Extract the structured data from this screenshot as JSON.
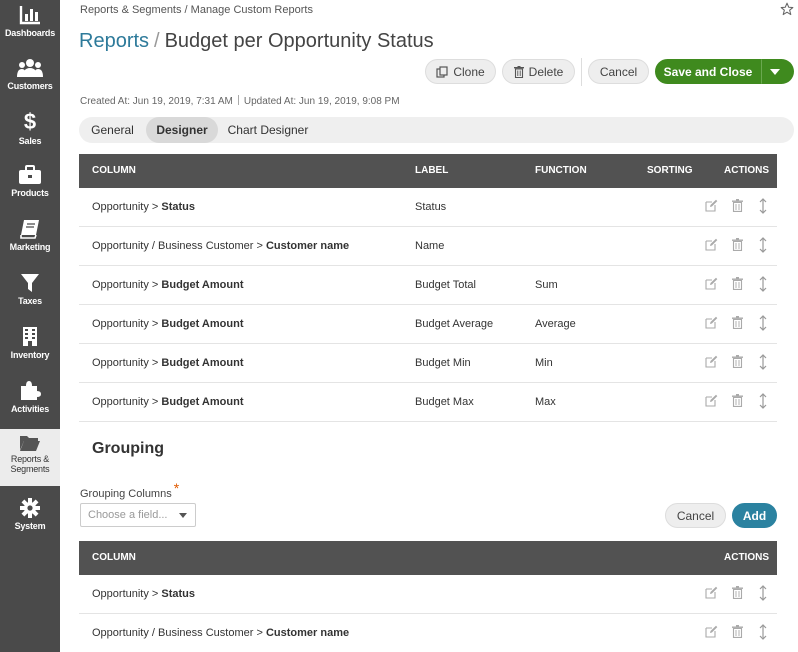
{
  "sidebar": {
    "items": [
      {
        "label": "Dashboards",
        "icon": "bar-chart-icon"
      },
      {
        "label": "Customers",
        "icon": "users-icon"
      },
      {
        "label": "Sales",
        "icon": "dollar-icon"
      },
      {
        "label": "Products",
        "icon": "briefcase-icon"
      },
      {
        "label": "Marketing",
        "icon": "book-icon"
      },
      {
        "label": "Taxes",
        "icon": "filter-icon"
      },
      {
        "label": "Inventory",
        "icon": "building-icon"
      },
      {
        "label": "Activities",
        "icon": "puzzle-icon"
      },
      {
        "label": "Reports &",
        "label2": "Segments",
        "icon": "folder-icon"
      },
      {
        "label": "System",
        "icon": "gear-icon"
      }
    ]
  },
  "breadcrumb": "Reports & Segments / Manage Custom Reports",
  "title": {
    "link": "Reports",
    "separator": "/",
    "name": "Budget per Opportunity Status"
  },
  "toolbar": {
    "clone": "Clone",
    "delete": "Delete",
    "cancel": "Cancel",
    "save": "Save and Close"
  },
  "meta": {
    "created": "Created At: Jun 19, 2019, 7:31 AM",
    "updated": "Updated At: Jun 19, 2019, 9:08 PM"
  },
  "tabs": [
    {
      "label": "General"
    },
    {
      "label": "Designer",
      "active": true
    },
    {
      "label": "Chart Designer"
    }
  ],
  "columns_table": {
    "headers": {
      "column": "COLUMN",
      "label": "LABEL",
      "function": "FUNCTION",
      "sorting": "SORTING",
      "actions": "ACTIONS"
    },
    "rows": [
      {
        "path": "Opportunity >",
        "field": "Status",
        "label": "Status",
        "function": ""
      },
      {
        "path": "Opportunity / Business Customer >",
        "field": "Customer name",
        "label": "Name",
        "function": ""
      },
      {
        "path": "Opportunity >",
        "field": "Budget Amount",
        "label": "Budget Total",
        "function": "Sum"
      },
      {
        "path": "Opportunity >",
        "field": "Budget Amount",
        "label": "Budget Average",
        "function": "Average"
      },
      {
        "path": "Opportunity >",
        "field": "Budget Amount",
        "label": "Budget Min",
        "function": "Min"
      },
      {
        "path": "Opportunity >",
        "field": "Budget Amount",
        "label": "Budget Max",
        "function": "Max"
      }
    ]
  },
  "grouping": {
    "title": "Grouping",
    "label": "Grouping Columns",
    "required_mark": "*",
    "placeholder": "Choose a field...",
    "cancel": "Cancel",
    "add": "Add",
    "headers": {
      "column": "COLUMN",
      "actions": "ACTIONS"
    },
    "rows": [
      {
        "path": "Opportunity >",
        "field": "Status"
      },
      {
        "path": "Opportunity / Business Customer >",
        "field": "Customer name"
      }
    ]
  },
  "colors": {
    "sidebar": "#4a4a4a",
    "accent_link": "#2d7a9a",
    "save": "#3f8a1e",
    "add": "#2b82a0",
    "table_header": "#525252"
  }
}
